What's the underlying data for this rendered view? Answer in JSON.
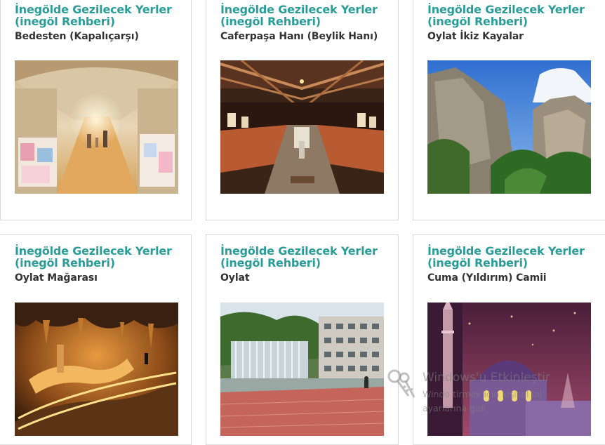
{
  "cards": [
    {
      "title": "İnegölde Gezilecek Yerler (inegöl Rehberi)",
      "subtitle": "Bedesten (Kapalıçarşı)",
      "image": "bedesten-bazaar-photo"
    },
    {
      "title": "İnegölde Gezilecek Yerler (inegöl Rehberi)",
      "subtitle": "Caferpaşa Hanı (Beylik Hanı)",
      "image": "caferpasa-hani-photo"
    },
    {
      "title": "İnegölde Gezilecek Yerler (inegöl Rehberi)",
      "subtitle": "Oylat İkiz Kayalar",
      "image": "oylat-twin-rocks-photo"
    },
    {
      "title": "İnegölde Gezilecek Yerler (inegöl Rehberi)",
      "subtitle": "Oylat Mağarası",
      "image": "oylat-cave-photo"
    },
    {
      "title": "İnegölde Gezilecek Yerler (inegöl Rehberi)",
      "subtitle": "Oylat",
      "image": "oylat-waterfall-photo"
    },
    {
      "title": "İnegölde Gezilecek Yerler (inegöl Rehberi)",
      "subtitle": "Cuma (Yıldırım) Camii",
      "image": "cuma-mosque-photo"
    }
  ],
  "watermark": {
    "title": "Windows'u Etkinleştir",
    "line1": "Windo               tirmek için kişisel bil",
    "line2": "ayarlarına gidi"
  },
  "colors": {
    "title": "#2a9d99",
    "subtitle": "#333333",
    "border": "#d9d9d9"
  }
}
